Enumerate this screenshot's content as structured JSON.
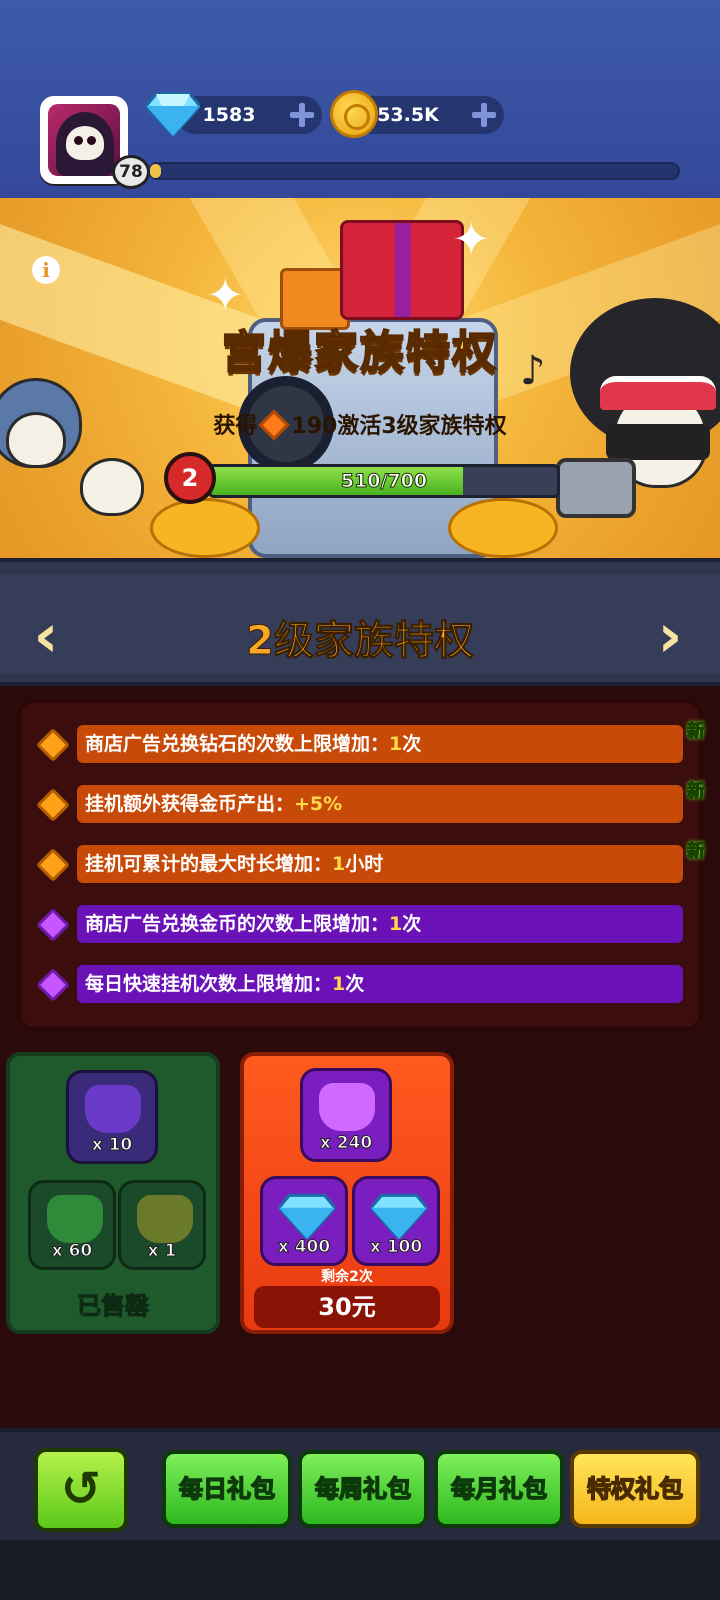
{
  "player": {
    "level": "78",
    "xp_fraction": 0.02
  },
  "resources": {
    "gems": "1583",
    "coins": "53.5K"
  },
  "banner": {
    "title": "宫爆家族特权",
    "subtitle_prefix": "获得",
    "subtitle_suffix": "190激活3级家族特权",
    "current_level": "2",
    "progress_text": "510/700",
    "progress_fraction": 0.729
  },
  "level_header": {
    "title": "2级家族特权",
    "prev": "‹",
    "next": "›"
  },
  "perks": [
    {
      "text": "商店广告兑换钻石的次数上限增加：",
      "value": "1",
      "unit": "次",
      "tier": "orange",
      "new_label": "新"
    },
    {
      "text": "挂机额外获得金币产出：",
      "value": "+5%",
      "unit": "",
      "tier": "orange",
      "new_label": "新"
    },
    {
      "text": "挂机可累计的最大时长增加：",
      "value": "1",
      "unit": "小时",
      "tier": "orange",
      "new_label": "新"
    },
    {
      "text": "商店广告兑换金币的次数上限增加：",
      "value": "1",
      "unit": "次",
      "tier": "purple",
      "new_label": ""
    },
    {
      "text": "每日快速挂机次数上限增加：",
      "value": "1",
      "unit": "次",
      "tier": "purple",
      "new_label": ""
    }
  ],
  "packs": [
    {
      "items": [
        {
          "icon": "purple-shirt-token-icon",
          "count": "x 10"
        },
        {
          "icon": "green-shirt-token-icon",
          "count": "x 60"
        },
        {
          "icon": "fast-forward-coin-icon",
          "count": "x 1"
        }
      ],
      "status": "已售罄"
    },
    {
      "items": [
        {
          "icon": "purple-shirt-token-icon",
          "count": "x 240"
        },
        {
          "icon": "diamond-icon",
          "count": "x 400"
        },
        {
          "icon": "diamond-icon",
          "count": "x 100"
        }
      ],
      "remaining": "剩余2次",
      "price": "30元"
    }
  ],
  "tabs": [
    {
      "label": "每日礼包",
      "active": false
    },
    {
      "label": "每周礼包",
      "active": false
    },
    {
      "label": "每月礼包",
      "active": false
    },
    {
      "label": "特权礼包",
      "active": true
    }
  ],
  "colors": {
    "progress_green": "#49b21f",
    "title_orange": "#f7a726",
    "perk_orange": "#c84a08",
    "perk_purple": "#6a12b8"
  }
}
